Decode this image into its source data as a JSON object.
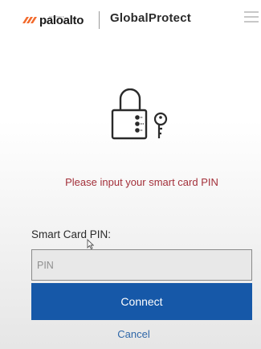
{
  "header": {
    "brand": "paloalto",
    "brand_sub": "NETWORKS",
    "product": "GlobalProtect",
    "menu_icon": "hamburger-menu-icon"
  },
  "main": {
    "illustration_icon": "padlock-key-icon",
    "prompt": "Please input your smart card PIN",
    "pin_label": "Smart Card PIN:",
    "pin_placeholder": "PIN",
    "pin_value": "",
    "connect_label": "Connect",
    "cancel_label": "Cancel"
  },
  "colors": {
    "prompt_text": "#a3303a",
    "connect_button": "#1658a8",
    "cancel_link": "#2f67a8",
    "brand_orange": "#f26b2d"
  }
}
